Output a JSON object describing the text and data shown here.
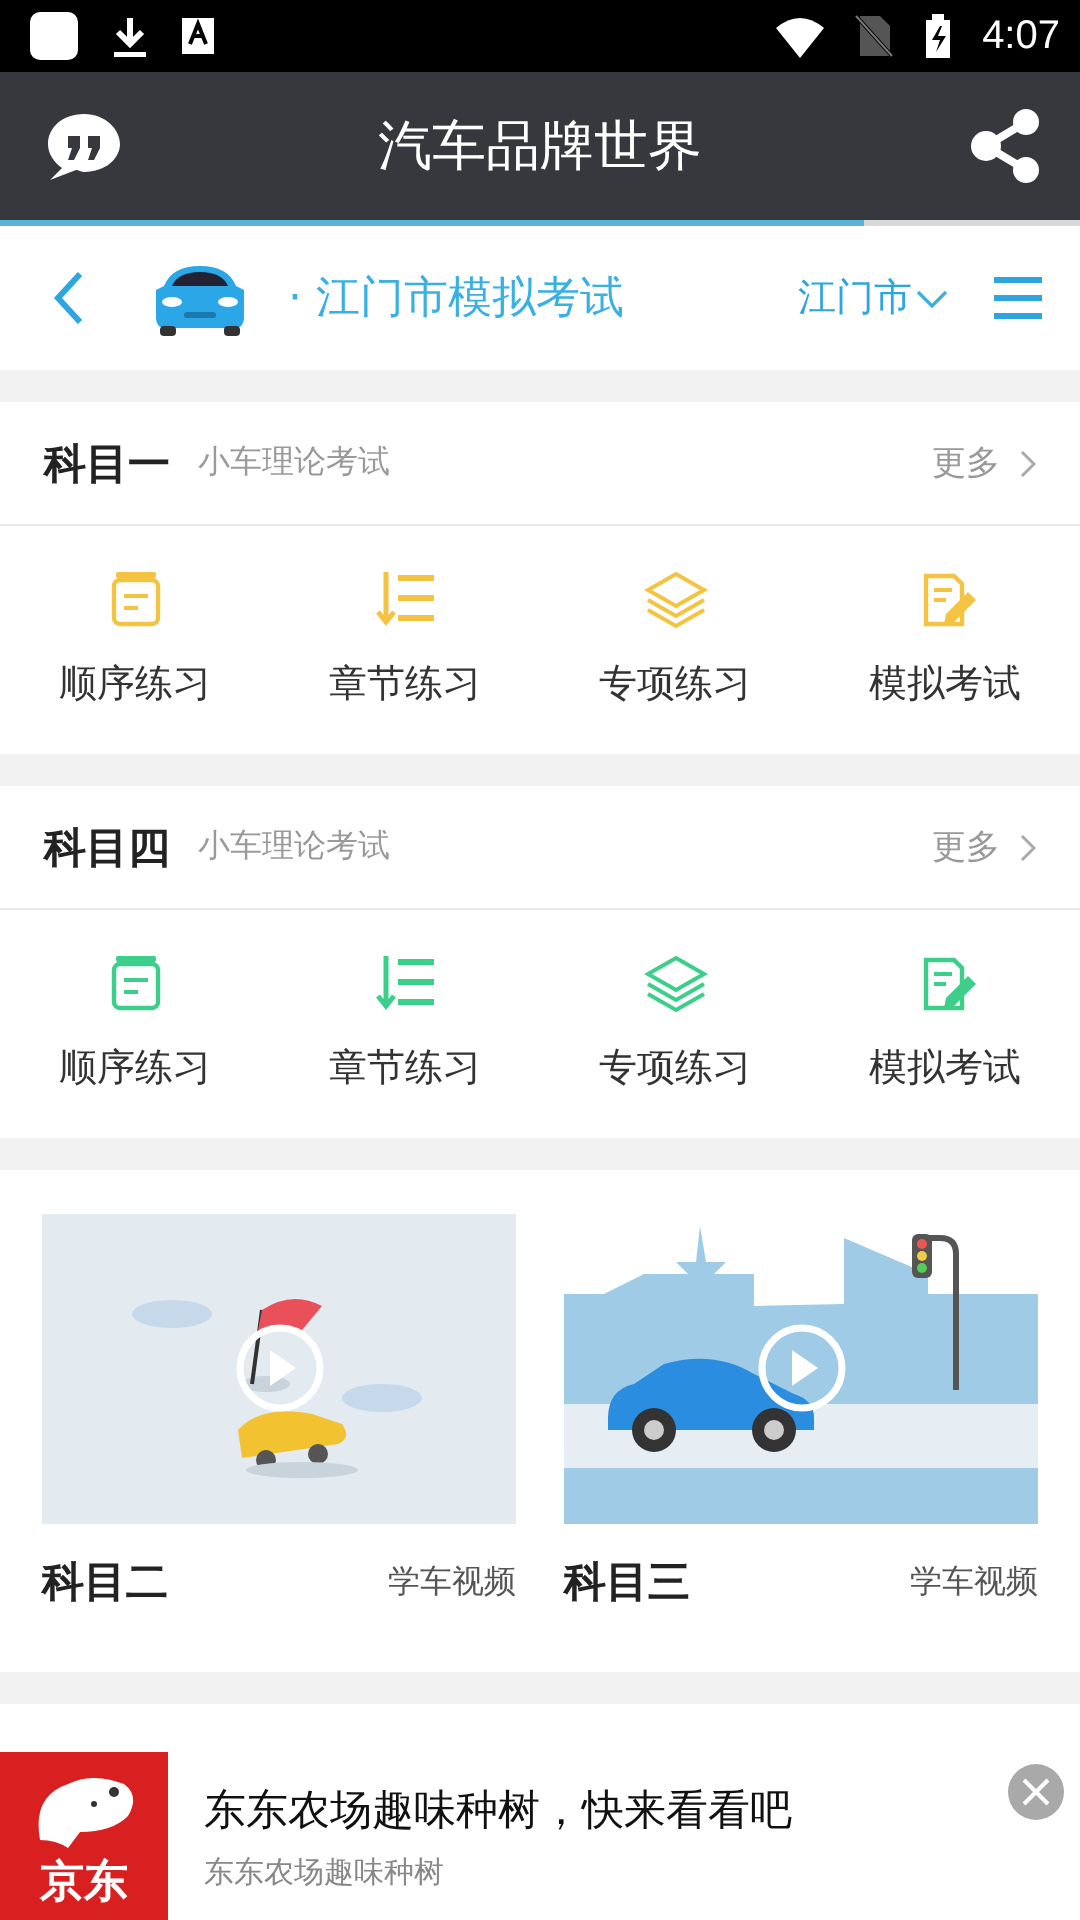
{
  "status_bar": {
    "time": "4:07"
  },
  "app_bar": {
    "title": "汽车品牌世界"
  },
  "page_progress": {
    "level": 0.8
  },
  "web_header": {
    "title": "· 江门市模拟考试",
    "city": "江门市"
  },
  "subjects": [
    {
      "title": "科目一",
      "subtitle": "小车理论考试",
      "more": "更多",
      "color": "#f5c342",
      "items": [
        {
          "kind": "sequence",
          "label": "顺序练习"
        },
        {
          "kind": "chapter",
          "label": "章节练习"
        },
        {
          "kind": "topic",
          "label": "专项练习"
        },
        {
          "kind": "exam",
          "label": "模拟考试"
        }
      ]
    },
    {
      "title": "科目四",
      "subtitle": "小车理论考试",
      "more": "更多",
      "color": "#3ccf8a",
      "items": [
        {
          "kind": "sequence",
          "label": "顺序练习"
        },
        {
          "kind": "chapter",
          "label": "章节练习"
        },
        {
          "kind": "topic",
          "label": "专项练习"
        },
        {
          "kind": "exam",
          "label": "模拟考试"
        }
      ]
    }
  ],
  "videos": [
    {
      "title": "科目二",
      "tag": "学车视频"
    },
    {
      "title": "科目三",
      "tag": "学车视频"
    }
  ],
  "ad": {
    "logo": "京东",
    "title": "东东农场趣味种树，快来看看吧",
    "subtitle": "东东农场趣味种树"
  }
}
